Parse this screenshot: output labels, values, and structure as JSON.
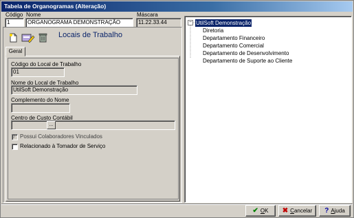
{
  "window": {
    "title": "Tabela de Organogramas (Alteração)"
  },
  "header": {
    "codigo_label": "Código",
    "codigo_value": "1",
    "nome_label": "Nome",
    "nome_value": "ORGANOGRAMA DEMONSTRAÇÃO",
    "mascara_label": "Máscara",
    "mascara_value": "11.22.33.44"
  },
  "section": {
    "title": "Locais de Trabalho",
    "tab_label": "Geral"
  },
  "form": {
    "codigo_local_label": "Código do Local de Trabalho",
    "codigo_local_value": "01",
    "nome_local_label": "Nome do Local de Trabalho",
    "nome_local_value": "UtilSoft Demonstração",
    "complemento_label": "Complemento do Nome",
    "complemento_value": "",
    "centro_custo_label": "Centro de Custo Contábil",
    "centro_custo_value": "",
    "browse_label": "...",
    "check_colaboradores_label": "Possui Colaboradores Vinculados",
    "check_colaboradores_checked": true,
    "check_tomador_label": "Relacionado à Tomador de Serviço",
    "check_tomador_checked": false
  },
  "tree": {
    "root": "UtilSoft Demonstração",
    "expander": "−",
    "children": [
      "Diretoria",
      "Departamento Financeiro",
      "Departamento Comercial",
      "Departamento de Desenvolvimento",
      "Departamento de Suporte ao Cliente"
    ]
  },
  "buttons": {
    "ok_label": "OK",
    "ok_ul": "O",
    "ok_rest": "K",
    "cancel_ul": "C",
    "cancel_rest": "ancelar",
    "help_ul": "A",
    "help_rest": "juda"
  },
  "colors": {
    "title_bar": "#0a246a",
    "heading": "#0a246a",
    "selection": "#0a246a",
    "ok_check": "#008000",
    "cancel_x": "#c00000"
  }
}
